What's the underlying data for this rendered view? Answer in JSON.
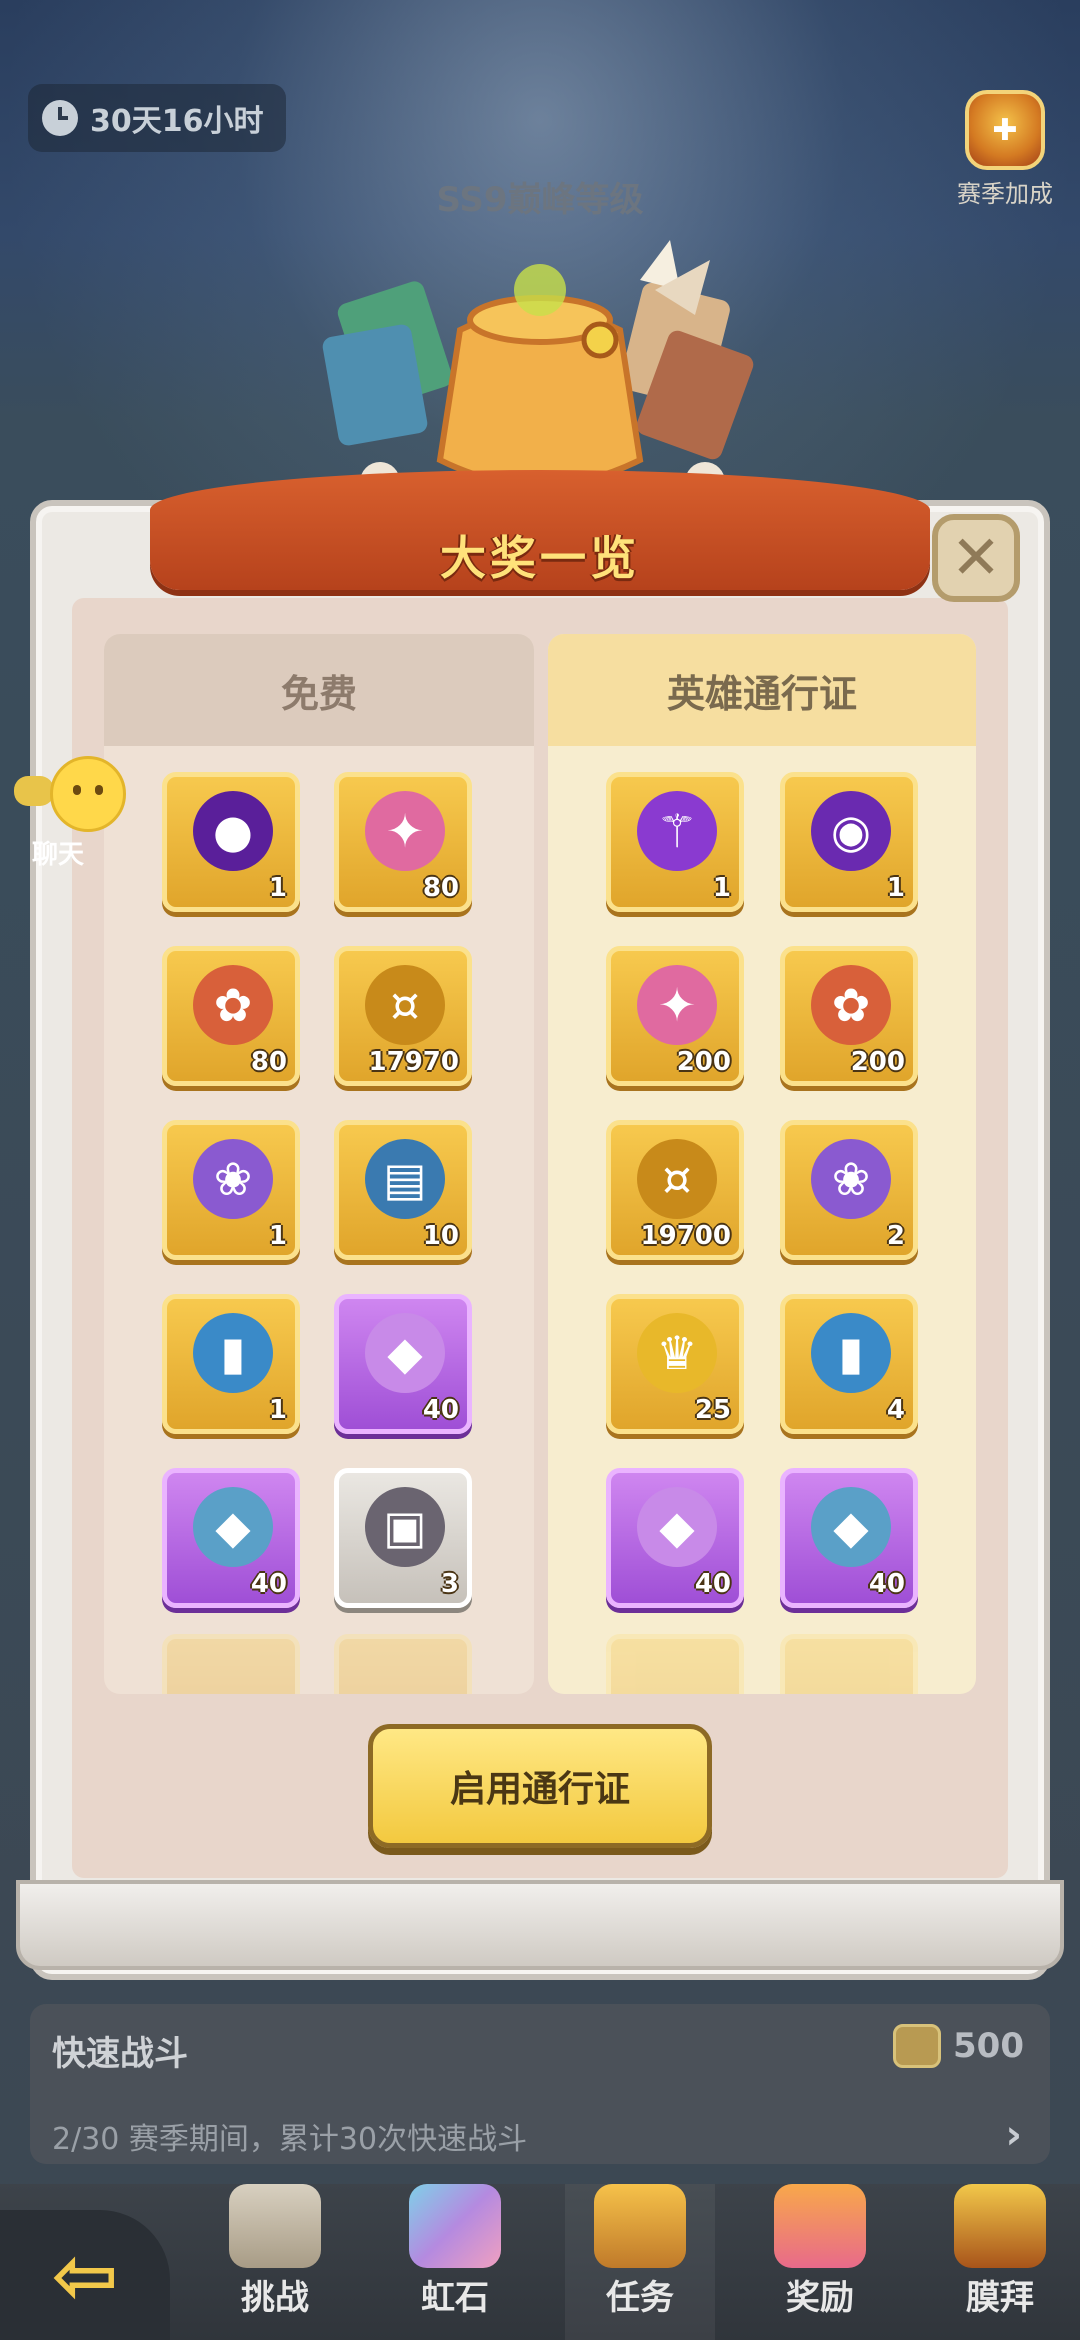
{
  "timer": "30天16小时",
  "season_boost": "赛季加成",
  "peak_level": "SS9巅峰等级",
  "modal_title": "大奖一览",
  "free_header": "免费",
  "pass_header": "英雄通行证",
  "free_items": [
    {
      "qty": "1",
      "icon": "purple-orb-icon",
      "tier": "gold"
    },
    {
      "qty": "80",
      "icon": "pink-gem-icon",
      "tier": "gold"
    },
    {
      "qty": "80",
      "icon": "candy-gem-icon",
      "tier": "gold"
    },
    {
      "qty": "17970",
      "icon": "gold-coin-icon",
      "tier": "gold"
    },
    {
      "qty": "1",
      "icon": "purple-bag-icon",
      "tier": "gold"
    },
    {
      "qty": "10",
      "icon": "map-scroll-icon",
      "tier": "gold"
    },
    {
      "qty": "1",
      "icon": "blue-ticket-icon",
      "tier": "gold"
    },
    {
      "qty": "40",
      "icon": "duck-crystal-icon",
      "tier": "purple"
    },
    {
      "qty": "40",
      "icon": "fish-crystal-icon",
      "tier": "purple"
    },
    {
      "qty": "3",
      "icon": "treasure-chest-icon",
      "tier": "silver"
    }
  ],
  "pass_items": [
    {
      "qty": "1",
      "icon": "magic-staff-icon",
      "tier": "gold"
    },
    {
      "qty": "1",
      "icon": "purple-frame-icon",
      "tier": "gold"
    },
    {
      "qty": "200",
      "icon": "pink-gem-icon",
      "tier": "gold"
    },
    {
      "qty": "200",
      "icon": "candy-gem-icon",
      "tier": "gold"
    },
    {
      "qty": "19700",
      "icon": "gold-coin-icon",
      "tier": "gold"
    },
    {
      "qty": "2",
      "icon": "purple-bag-icon",
      "tier": "gold"
    },
    {
      "qty": "25",
      "icon": "golden-figure-icon",
      "tier": "gold"
    },
    {
      "qty": "4",
      "icon": "blue-ticket-icon",
      "tier": "gold"
    },
    {
      "qty": "40",
      "icon": "duck-crystal-icon",
      "tier": "purple"
    },
    {
      "qty": "40",
      "icon": "fish-crystal-icon",
      "tier": "purple"
    }
  ],
  "activate_button": "启用通行证",
  "chat_label": "聊天",
  "quest": {
    "title": "快速战斗",
    "reward": "500",
    "desc": "2/30 赛季期间，累计30次快速战斗"
  },
  "nav": [
    "挑战",
    "虹石",
    "任务",
    "奖励",
    "膜拜"
  ],
  "colors": {
    "gold_tile": "#f7c94e",
    "purple_tile": "#cf86f0",
    "pass_header": "#f6dea0",
    "button": "#f3c93f"
  }
}
